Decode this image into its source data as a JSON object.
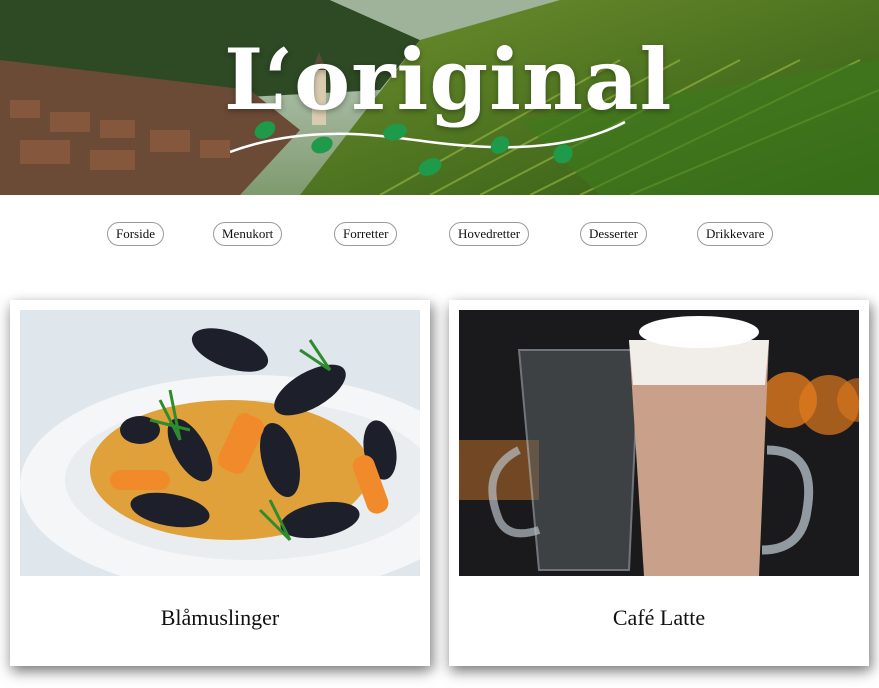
{
  "header": {
    "logo_text": "L‘original",
    "banner_image": "vineyard-village-landscape",
    "leaf_color": "#1f9a4a"
  },
  "nav": {
    "items": [
      {
        "label": "Forside"
      },
      {
        "label": "Menukort"
      },
      {
        "label": "Forretter"
      },
      {
        "label": "Hovedretter"
      },
      {
        "label": "Desserter"
      },
      {
        "label": "Drikkevare"
      }
    ]
  },
  "cards": [
    {
      "title": "Blåmuslinger",
      "image": "mussels-dish-photo"
    },
    {
      "title": "Café Latte",
      "image": "cafe-latte-glass-photo"
    }
  ]
}
